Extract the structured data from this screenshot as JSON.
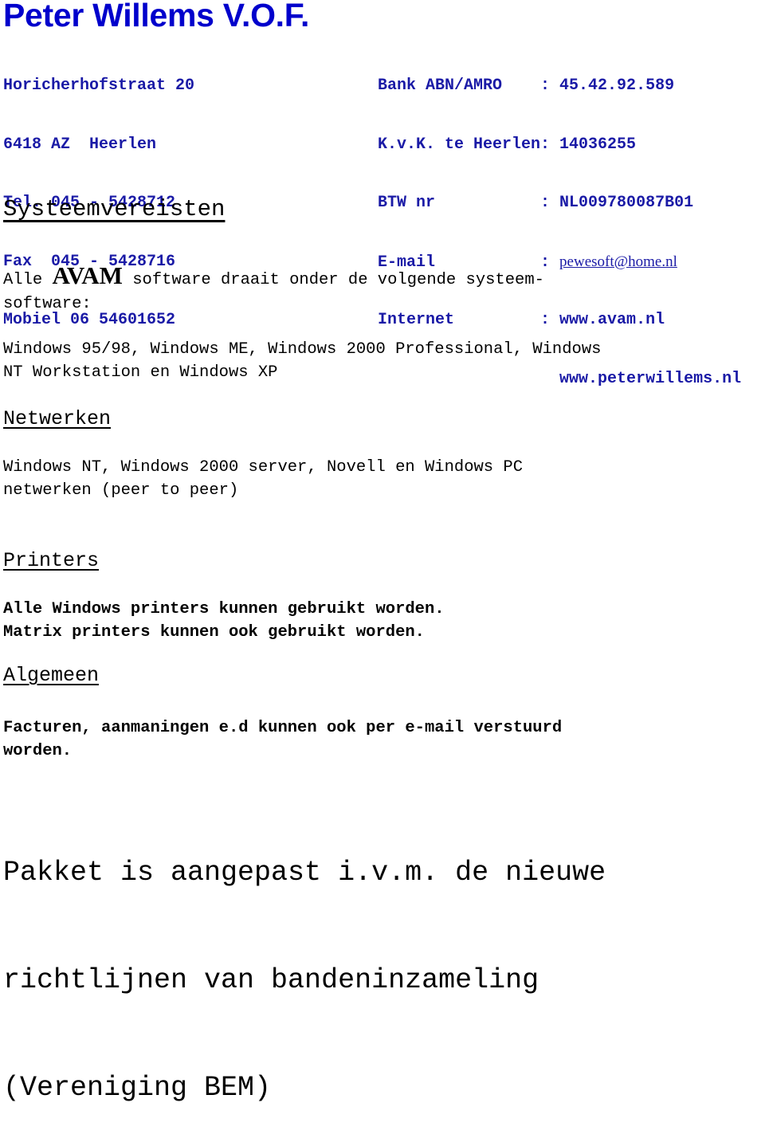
{
  "header": {
    "company_name": "Peter Willems V.O.F.",
    "left_lines": [
      "Horicherhofstraat 20",
      "6418 AZ  Heerlen",
      "Tel. 045 - 5428712",
      "Fax  045 - 5428716",
      "Mobiel 06 54601652"
    ],
    "right_rows": [
      {
        "label": "Bank ABN/AMRO    : ",
        "value": "45.42.92.589"
      },
      {
        "label": "K.v.K. te Heerlen: ",
        "value": "14036255"
      },
      {
        "label": "BTW nr           : ",
        "value": "NL009780087B01"
      },
      {
        "label": "E-mail           : ",
        "value": "pewesoft@home.nl"
      },
      {
        "label": "Internet         : ",
        "value": "www.avam.nl"
      },
      {
        "label": "                   ",
        "value": "www.peterwillems.nl"
      }
    ]
  },
  "sections": {
    "main_heading": "Systeemvereisten",
    "intro": {
      "pre": "Alle ",
      "brand": "AVAM",
      "post_line1": " software draait onder de volgende systeem-",
      "line2": "software:"
    },
    "os_lines": [
      "Windows 95/98, Windows ME, Windows 2000 Professional, Windows",
      "NT Workstation en Windows XP"
    ],
    "networks_heading": "Netwerken",
    "networks_lines": [
      "Windows NT, Windows 2000 server, Novell en Windows PC",
      "netwerken (peer to peer)"
    ],
    "printers_heading": "Printers",
    "printers_lines": [
      "Alle Windows printers kunnen gebruikt worden.",
      "Matrix printers kunnen ook gebruikt worden."
    ],
    "general_heading": "Algemeen",
    "general_lines": [
      "Facturen, aanmaningen e.d kunnen ook per e-mail verstuurd",
      "worden."
    ],
    "notice_lines": [
      "Pakket is aangepast i.v.m. de nieuwe",
      "richtlijnen van bandeninzameling",
      "(Vereniging BEM)"
    ]
  }
}
